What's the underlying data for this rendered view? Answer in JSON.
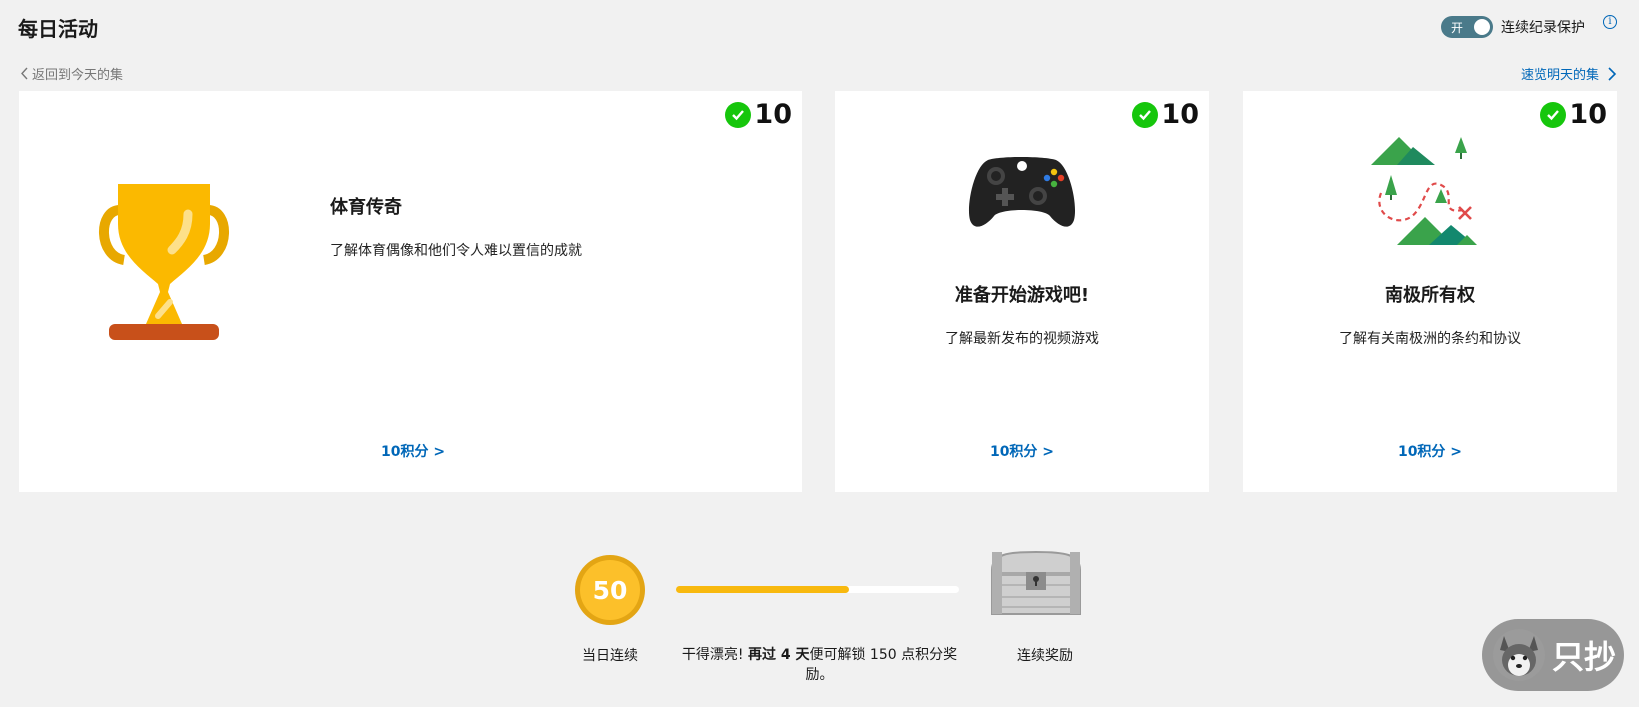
{
  "header": {
    "title": "每日活动",
    "toggle_state": "开",
    "toggle_label": "连续纪录保护",
    "info_icon": "i"
  },
  "nav": {
    "back_label": "返回到今天的集",
    "next_label": "速览明天的集"
  },
  "cards": [
    {
      "points_badge": "10",
      "title": "体育传奇",
      "description": "了解体育偶像和他们令人难以置信的成就",
      "link": "10积分 >",
      "icon": "trophy-icon"
    },
    {
      "points_badge": "10",
      "title": "准备开始游戏吧!",
      "description": "了解最新发布的视频游戏",
      "link": "10积分 >",
      "icon": "game-controller-icon"
    },
    {
      "points_badge": "10",
      "title": "南极所有权",
      "description": "了解有关南极洲的条约和协议",
      "link": "10积分 >",
      "icon": "treasure-map-icon"
    }
  ],
  "streak": {
    "count": "50",
    "label": "当日连续",
    "progress_fraction": 0.61,
    "message_prefix": "干得漂亮! ",
    "message_bold": "再过 4 天",
    "message_suffix": "便可解锁 150 点积分奖励。",
    "reward_label": "连续奖励"
  },
  "watermark": {
    "text": "只抄"
  },
  "colors": {
    "accent": "#0067b8",
    "check_green": "#16c60c",
    "progress": "#f8b90f",
    "toggle": "#4a7a8a"
  }
}
